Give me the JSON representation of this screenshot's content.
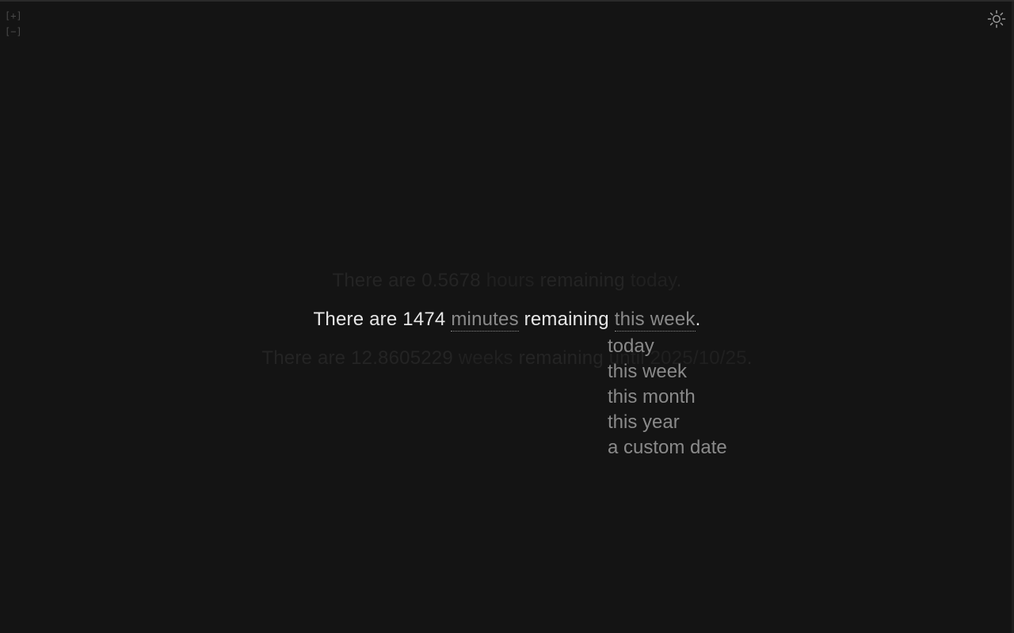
{
  "zoom": {
    "in_label": "[+]",
    "out_label": "[−]"
  },
  "theme_toggle": {
    "icon": "sun-icon"
  },
  "lines": {
    "previous": {
      "prefix": "There are ",
      "value": "0.5678",
      "unit": "hours",
      "middle": " remaining ",
      "period": "today",
      "suffix": "."
    },
    "active": {
      "prefix": "There are ",
      "value": "1474",
      "unit": "minutes",
      "middle": " remaining ",
      "period": "this week",
      "suffix": "."
    },
    "next": {
      "prefix": "There are ",
      "value": "12.8605229",
      "unit": "weeks",
      "middle": " remaining ",
      "period": "until 2025/10/25",
      "suffix": "."
    }
  },
  "period_dropdown": {
    "options": [
      "today",
      "this week",
      "this month",
      "this year",
      "a custom date"
    ]
  },
  "colors": {
    "background": "#141414",
    "text_active": "#e6e6e6",
    "link": "#8a8a8a",
    "text_faded": "#242424"
  }
}
